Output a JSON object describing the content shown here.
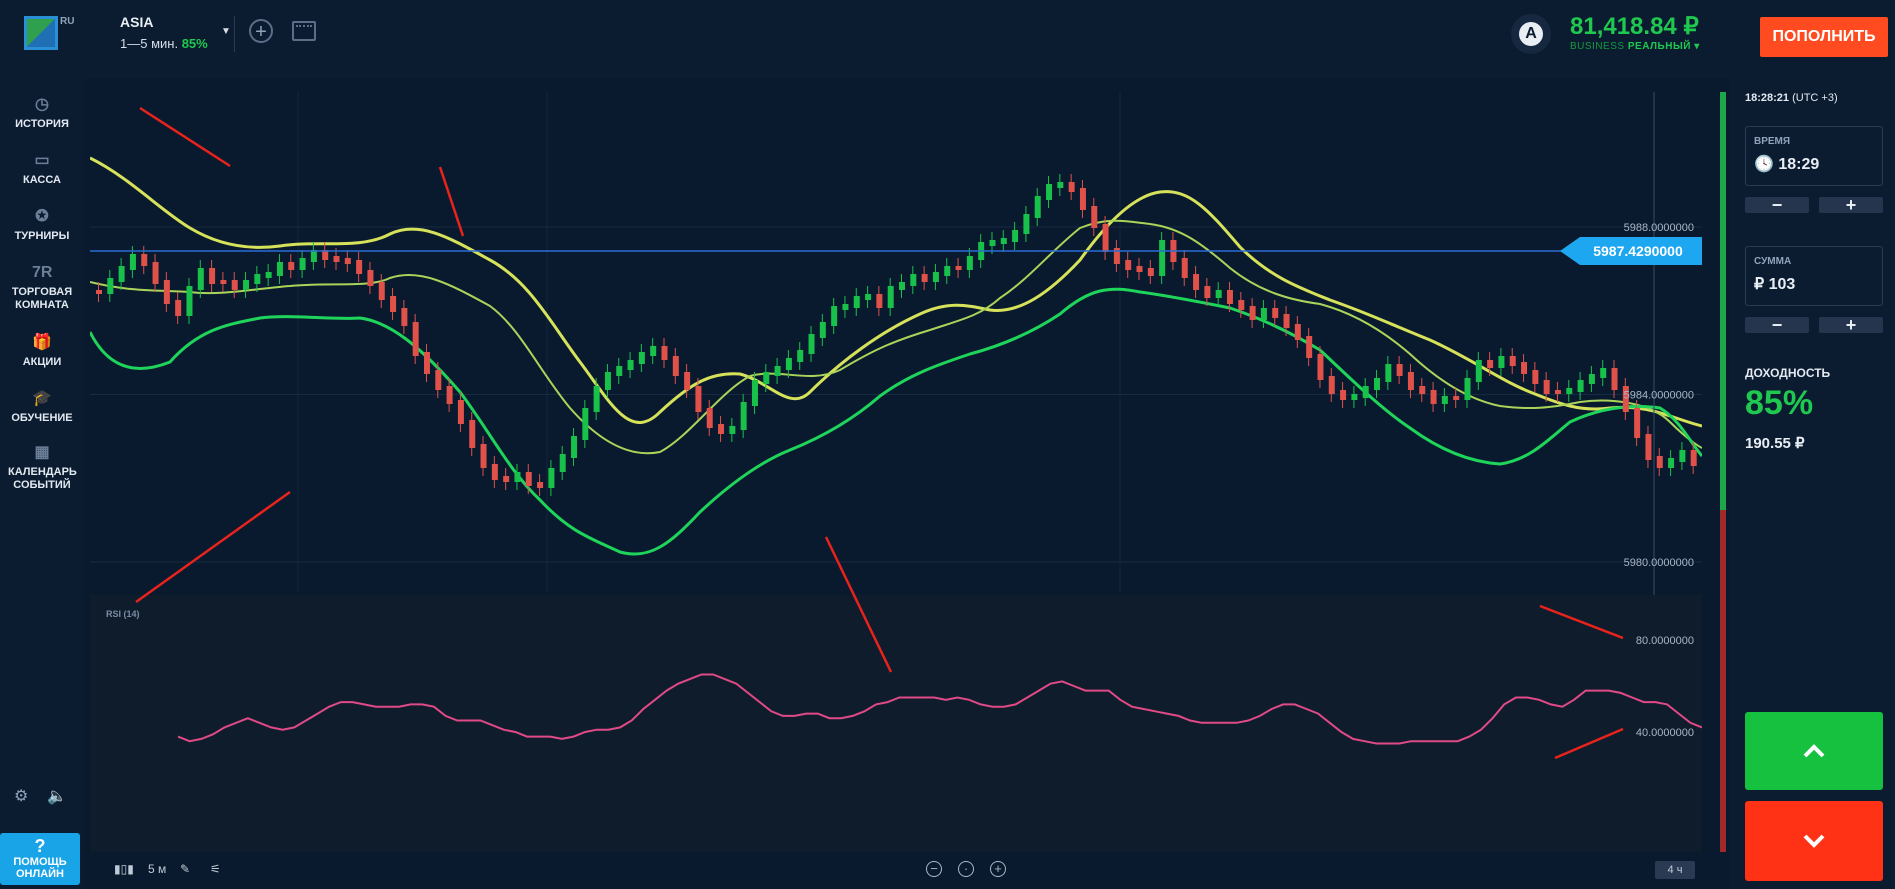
{
  "header": {
    "logo_suffix": "RU",
    "asset_name": "ASIA",
    "asset_expiry": "1—5 мин.",
    "asset_payout": "85%",
    "balance": "81,418.84 ₽",
    "account_level": "BUSINESS",
    "account_type": "РЕАЛЬНЫЙ ▾",
    "avatar_letter": "A",
    "deposit_label": "ПОПОЛНИТЬ"
  },
  "sidebar": {
    "items": [
      {
        "label": "ИСТОРИЯ",
        "icon": "history-icon",
        "glyph": "◷"
      },
      {
        "label": "КАССА",
        "icon": "wallet-icon",
        "glyph": "▭"
      },
      {
        "label": "ТУРНИРЫ",
        "icon": "star-icon",
        "glyph": "✪"
      },
      {
        "label": "ТОРГОВАЯ КОМНАТА",
        "icon": "trading-room-icon",
        "glyph": "7R"
      },
      {
        "label": "АКЦИИ",
        "icon": "gift-icon",
        "glyph": "🎁"
      },
      {
        "label": "ОБУЧЕНИЕ",
        "icon": "graduation-icon",
        "glyph": "🎓"
      },
      {
        "label": "КАЛЕНДАРЬ СОБЫТИЙ",
        "icon": "calendar-icon",
        "glyph": "▦"
      }
    ],
    "help_label": "ПОМОЩЬ ОНЛАЙН",
    "help_glyph": "?"
  },
  "chart": {
    "price_ticks": [
      "5988.0000000",
      "5984.0000000",
      "5980.0000000"
    ],
    "current_price": "5987.4290000",
    "rsi_label": "RSI (14)",
    "rsi_ticks": [
      "80.0000000",
      "40.0000000"
    ],
    "colors": {
      "bull": "#17c14a",
      "bear": "#e0514a",
      "bb_upper": "#d6e25a",
      "bb_mid": "#a9d45a",
      "bb_lower": "#1fd45a",
      "rsi": "#e04a86",
      "price_line": "#2b6cd6"
    }
  },
  "chart_data": {
    "type": "candlestick",
    "title": "",
    "y_ticks": [
      5988,
      5984,
      5980
    ],
    "current_price": 5987.429,
    "rsi": {
      "period": 14,
      "ticks": [
        80,
        40
      ],
      "values": [
        38,
        36,
        37,
        39,
        42,
        44,
        46,
        44,
        42,
        41,
        42,
        45,
        48,
        51,
        53,
        53,
        52,
        51,
        51,
        51,
        52,
        52,
        51,
        47,
        45,
        45,
        45,
        43,
        41,
        40,
        38,
        38,
        38,
        37,
        38,
        40,
        41,
        41,
        42,
        45,
        50,
        54,
        58,
        61,
        63,
        65,
        65,
        63,
        61,
        57,
        53,
        49,
        47,
        47,
        48,
        48,
        46,
        46,
        47,
        49,
        52,
        53,
        55,
        55,
        55,
        55,
        54,
        55,
        54,
        52,
        51,
        51,
        52,
        55,
        58,
        61,
        62,
        60,
        58,
        58,
        58,
        54,
        51,
        50,
        49,
        48,
        47,
        45,
        44,
        44,
        44,
        44,
        45,
        47,
        50,
        52,
        52,
        50,
        48,
        44,
        40,
        37,
        36,
        35,
        35,
        35,
        36,
        36,
        36,
        36,
        36,
        38,
        41,
        46,
        52,
        55,
        55,
        54,
        52,
        51,
        54,
        58,
        58,
        58,
        57,
        55,
        53,
        53,
        52,
        48,
        44,
        42
      ]
    },
    "price_arrow_label": "5987.4290000"
  },
  "chart_footer": {
    "timeframe": "5 м",
    "zoom_range": "4 ч"
  },
  "right": {
    "clock": "18:28:21",
    "tz": "(UTC +3)",
    "time_label": "ВРЕМЯ",
    "time_value": "18:29",
    "amount_label": "СУММА",
    "amount_value": "₽ 103",
    "minus": "−",
    "plus": "+",
    "yield_label": "ДОХОДНОСТЬ",
    "yield_value": "85%",
    "payout_value": "190.55 ₽"
  }
}
